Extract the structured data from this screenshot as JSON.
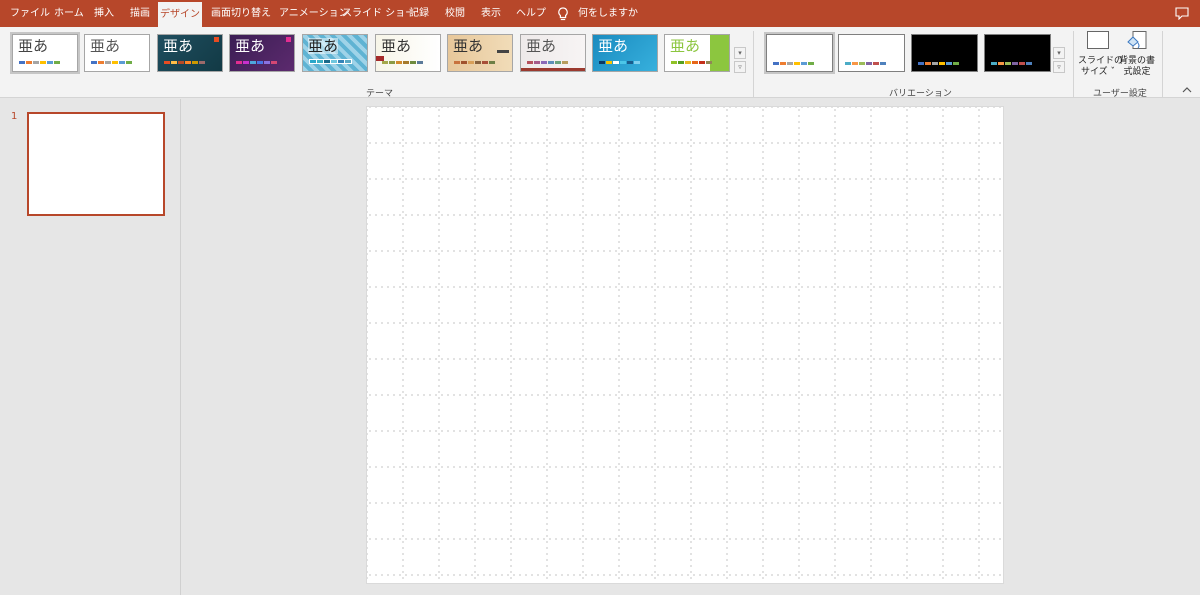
{
  "tabs": [
    {
      "label": "ファイル"
    },
    {
      "label": "ホーム"
    },
    {
      "label": "挿入"
    },
    {
      "label": "描画"
    },
    {
      "label": "デザイン"
    },
    {
      "label": "画面切り替え"
    },
    {
      "label": "アニメーション"
    },
    {
      "label": "スライド ショー"
    },
    {
      "label": "記録"
    },
    {
      "label": "校閲"
    },
    {
      "label": "表示"
    },
    {
      "label": "ヘルプ"
    }
  ],
  "active_tab": "デザイン",
  "tell_me": "何をしますか",
  "themes": {
    "group_label": "テーマ",
    "items": [
      {
        "glyph": "亜あ"
      },
      {
        "glyph": "亜あ"
      },
      {
        "glyph": "亜あ"
      },
      {
        "glyph": "亜あ"
      },
      {
        "glyph": "亜あ"
      },
      {
        "glyph": "亜あ"
      },
      {
        "glyph": "亜あ"
      },
      {
        "glyph": "亜あ"
      },
      {
        "glyph": "亜あ"
      },
      {
        "glyph": "亜あ"
      }
    ]
  },
  "variations": {
    "group_label": "バリエーション"
  },
  "customize": {
    "group_label": "ユーザー設定",
    "slide_size_line1": "スライドの",
    "slide_size_line2": "サイズ ˇ",
    "format_bg_line1": "背景の書",
    "format_bg_line2": "式設定"
  },
  "slides_panel": {
    "slide_number": "1"
  },
  "colors": {
    "accent": "#b7472a",
    "ribbon_bg": "#f3f3f3",
    "workspace_bg": "#e6e6e6"
  }
}
